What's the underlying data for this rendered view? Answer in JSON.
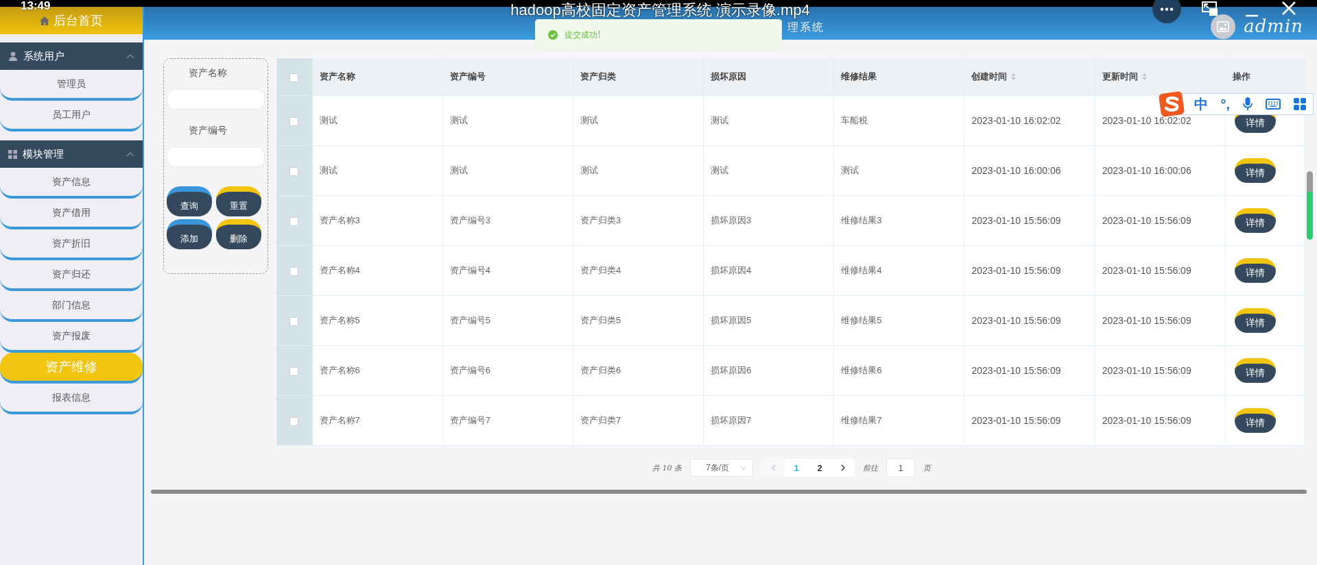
{
  "video_overlay": {
    "time": "13:49",
    "title": "hadoop高校固定资产管理系统 演示录像.mp4"
  },
  "header": {
    "home": "后台首页",
    "title": "理系统",
    "user": "admin"
  },
  "toast": {
    "message": "提交成功!"
  },
  "sidebar": {
    "sections": [
      {
        "title": "系统用户",
        "kind": "user",
        "expanded": true,
        "items": [
          {
            "label": "管理员",
            "selected": false
          },
          {
            "label": "员工用户",
            "selected": false
          }
        ]
      },
      {
        "title": "模块管理",
        "kind": "grid",
        "expanded": true,
        "items": [
          {
            "label": "资产信息",
            "selected": false
          },
          {
            "label": "资产借用",
            "selected": false
          },
          {
            "label": "资产折旧",
            "selected": false
          },
          {
            "label": "资产归还",
            "selected": false
          },
          {
            "label": "部门信息",
            "selected": false
          },
          {
            "label": "资产报废",
            "selected": false
          },
          {
            "label": "资产维修",
            "selected": true
          },
          {
            "label": "报表信息",
            "selected": false
          }
        ]
      }
    ]
  },
  "search": {
    "fields": [
      {
        "label": "资产名称"
      },
      {
        "label": "资产编号"
      }
    ],
    "buttons": [
      {
        "label": "查询",
        "color": "#3a97d9"
      },
      {
        "label": "重置",
        "color": "#f1c40f"
      },
      {
        "label": "添加",
        "color": "#3a97d9"
      },
      {
        "label": "删除",
        "color": "#f1c40f"
      }
    ]
  },
  "table": {
    "all_checked": false,
    "columns": [
      {
        "label": "资产名称",
        "sortable": false
      },
      {
        "label": "资产编号",
        "sortable": false
      },
      {
        "label": "资产归类",
        "sortable": false
      },
      {
        "label": "损坏原因",
        "sortable": false
      },
      {
        "label": "维修结果",
        "sortable": false
      },
      {
        "label": "创建时间",
        "sortable": true
      },
      {
        "label": "更新时间",
        "sortable": true
      },
      {
        "label": "操作",
        "sortable": false
      }
    ],
    "rows": [
      {
        "checked": false,
        "cells": [
          "测试",
          "测试",
          "测试",
          "测试",
          "车船税",
          "2023-01-10 16:02:02",
          "2023-01-10 16:02:02"
        ],
        "action": "详情"
      },
      {
        "checked": false,
        "cells": [
          "测试",
          "测试",
          "测试",
          "测试",
          "测试",
          "2023-01-10 16:00:06",
          "2023-01-10 16:00:06"
        ],
        "action": "详情"
      },
      {
        "checked": false,
        "cells": [
          "资产名称3",
          "资产编号3",
          "资产归类3",
          "损坏原因3",
          "维修结果3",
          "2023-01-10 15:56:09",
          "2023-01-10 15:56:09"
        ],
        "action": "详情"
      },
      {
        "checked": false,
        "cells": [
          "资产名称4",
          "资产编号4",
          "资产归类4",
          "损坏原因4",
          "维修结果4",
          "2023-01-10 15:56:09",
          "2023-01-10 15:56:09"
        ],
        "action": "详情"
      },
      {
        "checked": false,
        "cells": [
          "资产名称5",
          "资产编号5",
          "资产归类5",
          "损坏原因5",
          "维修结果5",
          "2023-01-10 15:56:09",
          "2023-01-10 15:56:09"
        ],
        "action": "详情"
      },
      {
        "checked": false,
        "cells": [
          "资产名称6",
          "资产编号6",
          "资产归类6",
          "损坏原因6",
          "维修结果6",
          "2023-01-10 15:56:09",
          "2023-01-10 15:56:09"
        ],
        "action": "详情"
      },
      {
        "checked": false,
        "cells": [
          "资产名称7",
          "资产编号7",
          "资产归类7",
          "损坏原因7",
          "维修结果7",
          "2023-01-10 15:56:09",
          "2023-01-10 15:56:09"
        ],
        "action": "详情"
      }
    ]
  },
  "pagination": {
    "total": "共 10 条",
    "page_size": "7条/页",
    "pages": [
      {
        "label": "1",
        "selected": true
      },
      {
        "label": "2",
        "selected": false
      }
    ],
    "goto_label": "前往",
    "goto_value": "1",
    "goto_suffix": "页"
  },
  "ime_toolbar": {
    "lang": "中",
    "punct": "°,"
  }
}
